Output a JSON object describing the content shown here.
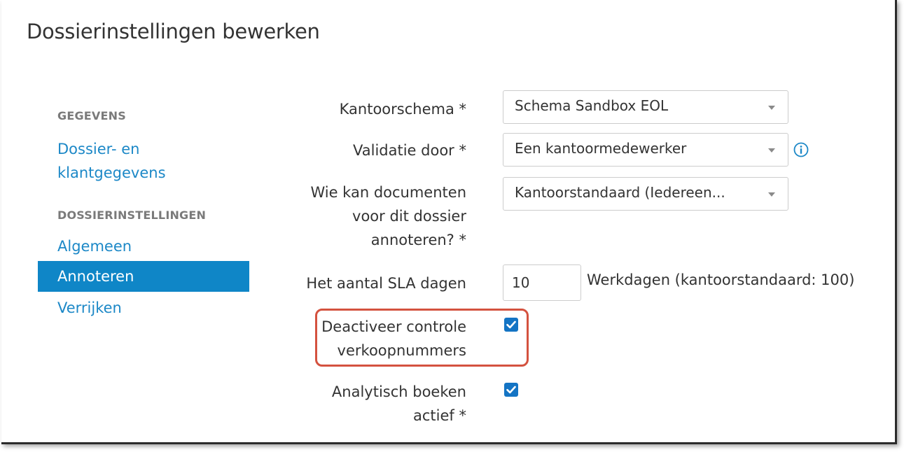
{
  "page": {
    "title": "Dossierinstellingen bewerken"
  },
  "sidebar": {
    "section_gegevens": "GEGEVENS",
    "link_dossier_line1": "Dossier- en",
    "link_dossier_line2": "klantgegevens",
    "section_dossierinstellingen": "DOSSIERINSTELLINGEN",
    "items": [
      {
        "label": "Algemeen",
        "active": false
      },
      {
        "label": "Annoteren",
        "active": true
      },
      {
        "label": "Verrijken",
        "active": false
      }
    ]
  },
  "form": {
    "kantoorschema": {
      "label": "Kantoorschema *",
      "value": "Schema Sandbox EOL"
    },
    "validatie": {
      "label": "Validatie door *",
      "value": "Een kantoormedewerker",
      "info_icon": "info-circle-icon"
    },
    "annoteren": {
      "label_line1": "Wie kan documenten",
      "label_line2": "voor dit dossier",
      "label_line3": "annoteren? *",
      "value": "Kantoorstandaard (Iedereen..."
    },
    "sla": {
      "label": "Het aantal SLA dagen",
      "value": "10",
      "suffix": "Werkdagen (kantoorstandaard: 100)"
    },
    "deactiveer": {
      "label_line1": "Deactiveer controle",
      "label_line2": "verkoopnummers",
      "checked": true
    },
    "analytisch": {
      "label_line1": "Analytisch boeken",
      "label_line2": "actief *",
      "checked": true
    }
  },
  "colors": {
    "accent": "#1c88c7",
    "active_bg": "#0f86c7",
    "checkbox": "#1474c4",
    "highlight": "#d4523f"
  }
}
